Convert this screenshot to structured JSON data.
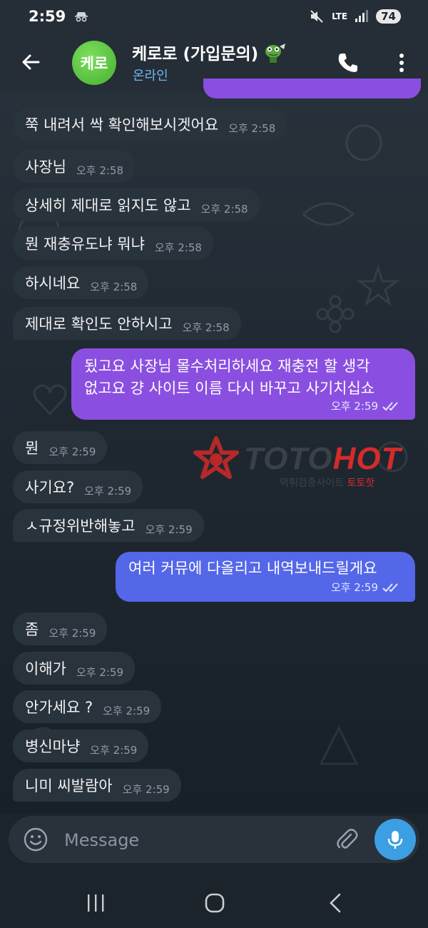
{
  "status_bar": {
    "time": "2:59",
    "network": "LTE",
    "battery": "74"
  },
  "header": {
    "avatar_text": "케로",
    "title": "케로로 (가입문의)",
    "status": "온라인"
  },
  "messages": [
    {
      "dir": "in",
      "text": "쭉 내려서 싹 확인해보시겟어요",
      "time": "오후 2:58"
    },
    {
      "dir": "in",
      "text": "사장님",
      "time": "오후 2:58"
    },
    {
      "dir": "in",
      "text": "상세히 제대로 읽지도 않고",
      "time": "오후 2:58"
    },
    {
      "dir": "in",
      "text": "뭔 재충유도냐 뭐냐",
      "time": "오후 2:58"
    },
    {
      "dir": "in",
      "text": "하시네요",
      "time": "오후 2:58"
    },
    {
      "dir": "in",
      "text": "제대로 확인도 안하시고",
      "time": "오후 2:58"
    },
    {
      "dir": "out",
      "line1": "됬고요 사장님 몰수처리하세요 재충전 할 생각",
      "line2": "없고요 걍 사이트 이름 다시 바꾸고 사기치십쇼",
      "time": "오후 2:59"
    },
    {
      "dir": "in",
      "text": "뭔",
      "time": "오후 2:59"
    },
    {
      "dir": "in",
      "text": "사기요?",
      "time": "오후 2:59"
    },
    {
      "dir": "in",
      "text": "ㅅ규정위반해놓고",
      "time": "오후 2:59"
    },
    {
      "dir": "out",
      "text": "여러 커뮤에 다올리고 내역보내드릴게요",
      "time": "오후 2:59"
    },
    {
      "dir": "in",
      "text": "좀",
      "time": "오후 2:59"
    },
    {
      "dir": "in",
      "text": "이해가",
      "time": "오후 2:59"
    },
    {
      "dir": "in",
      "text": "안가세요 ?",
      "time": "오후 2:59"
    },
    {
      "dir": "in",
      "text": "병신마냥",
      "time": "오후 2:59"
    },
    {
      "dir": "in",
      "text": "니미 씨발람아",
      "time": "오후 2:59"
    }
  ],
  "watermark": {
    "brand_part1": "TOTO",
    "brand_part2": "HOT",
    "subtitle_part1": "먹튀검증사이트",
    "subtitle_part2": "토토핫"
  },
  "input": {
    "placeholder": "Message"
  },
  "colors": {
    "outgoing_purple": "#8a4fe0",
    "outgoing_blue": "#5367e8",
    "incoming": "#29333c",
    "accent_blue": "#3d9fe3",
    "online_text": "#6cb8f0"
  }
}
